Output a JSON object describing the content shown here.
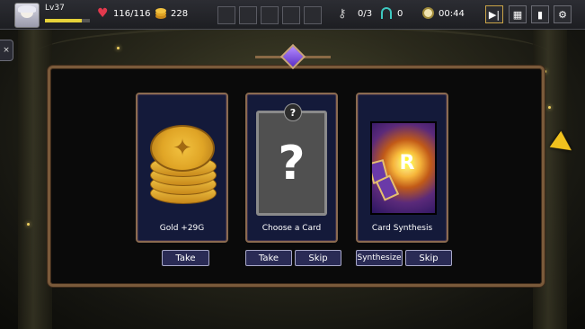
{
  "hud": {
    "level": "Lv37",
    "xp_fraction": 0.82,
    "hp": "116/116",
    "gold": "228",
    "keys": "0/3",
    "portals": "0",
    "timer": "00:44",
    "icons": [
      "heart-icon",
      "coin-icon",
      "key-icon",
      "portal-icon",
      "clock-icon",
      "skip-icon",
      "map-icon",
      "deck-icon",
      "gear-icon"
    ]
  },
  "side": {
    "tab_icon": "×"
  },
  "rewards": [
    {
      "label": "Gold +29G"
    },
    {
      "label": "Choose a Card",
      "badge": "?",
      "mark": "?"
    },
    {
      "label": "Card Synthesis",
      "rune": "R"
    }
  ],
  "buttons": {
    "take": "Take",
    "skip": "Skip",
    "synthesize": "Synthesize"
  },
  "colors": {
    "accent_border": "#7a5a3a",
    "button_bg": "#2a2b55",
    "gold": "#f2c240"
  }
}
